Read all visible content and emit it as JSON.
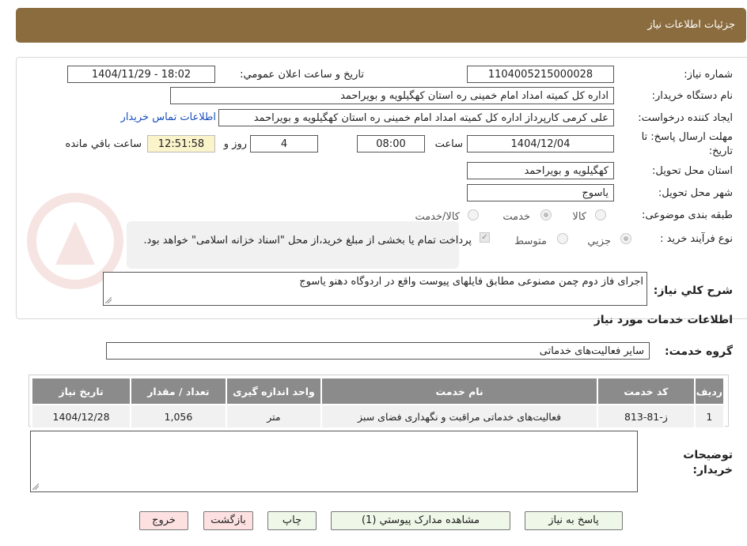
{
  "header": {
    "title": "جزئیات اطلاعات نیاز"
  },
  "fields": {
    "need_number_label": "شماره نیاز:",
    "need_number": "1104005215000028",
    "announce_label": "تاریخ و ساعت اعلان عمومي:",
    "announce_value": "1404/11/29 - 18:02",
    "buyer_org_label": "نام دستگاه خريدار:",
    "buyer_org": "اداره کل کمیته امداد امام خمینی  ره  استان کهگیلویه و بویراحمد",
    "requester_label": "ايجاد كننده درخواست:",
    "requester": "علی کرمی کارپرداز اداره کل کمیته امداد امام خمینی  ره  استان کهگیلویه و بویراحمد",
    "contact_link": "اطلاعات تماس خريدار",
    "deadline_label_1": "مهلت ارسال پاسخ: تا",
    "deadline_label_2": "تاريخ:",
    "deadline_date": "1404/12/04",
    "time_label": "ساعت",
    "deadline_time": "08:00",
    "days_value": "4",
    "days_label": "روز و",
    "remaining_time": "12:51:58",
    "remaining_label": "ساعت باقي مانده",
    "province_label": "استان محل تحويل:",
    "province": "کهگیلویه و بویراحمد",
    "city_label": "شهر محل تحويل:",
    "city": "یاسوج",
    "category_label": "طبقه بندی موضوعی:",
    "category_options": [
      "کالا",
      "خدمت",
      "کالا/خدمت"
    ],
    "process_label": "نوع فرآيند خريد :",
    "process_options": [
      "جزيي",
      "متوسط"
    ],
    "payment_note": "پرداخت تمام يا بخشی از مبلغ خريد،از محل \"اسناد خزانه اسلامی\" خواهد بود.",
    "description_label": "شرح كلي نياز:",
    "description": "اجرای فاز دوم چمن مصنوعی مطابق فایلهای پیوست واقع در اردوگاه دهنو یاسوج",
    "services_heading": "اطلاعات خدمات مورد نياز",
    "service_group_label": "گروه خدمت:",
    "service_group": "سایر فعالیت‌های خدماتی",
    "buyer_notes_label_1": "توضيحات",
    "buyer_notes_label_2": "خريدار:"
  },
  "table": {
    "headers": [
      "رديف",
      "كد خدمت",
      "نام خدمت",
      "واحد اندازه گيری",
      "تعداد / مقدار",
      "تاريخ نياز"
    ],
    "rows": [
      [
        "1",
        "ز-81-813",
        "فعالیت‌های خدماتی مراقبت و نگهداری فضای سبز",
        "متر",
        "1,056",
        "1404/12/28"
      ]
    ]
  },
  "buttons": {
    "reply": "پاسخ به نياز",
    "attachments": "مشاهده مدارک پيوستي (1)",
    "print": "چاپ",
    "back": "بازگشت",
    "exit": "خروج"
  },
  "colors": {
    "header": "#8b6c3e",
    "table_header": "#8b8b8b",
    "timer_bg": "#fbf3c9",
    "link": "#1a4fbf"
  }
}
